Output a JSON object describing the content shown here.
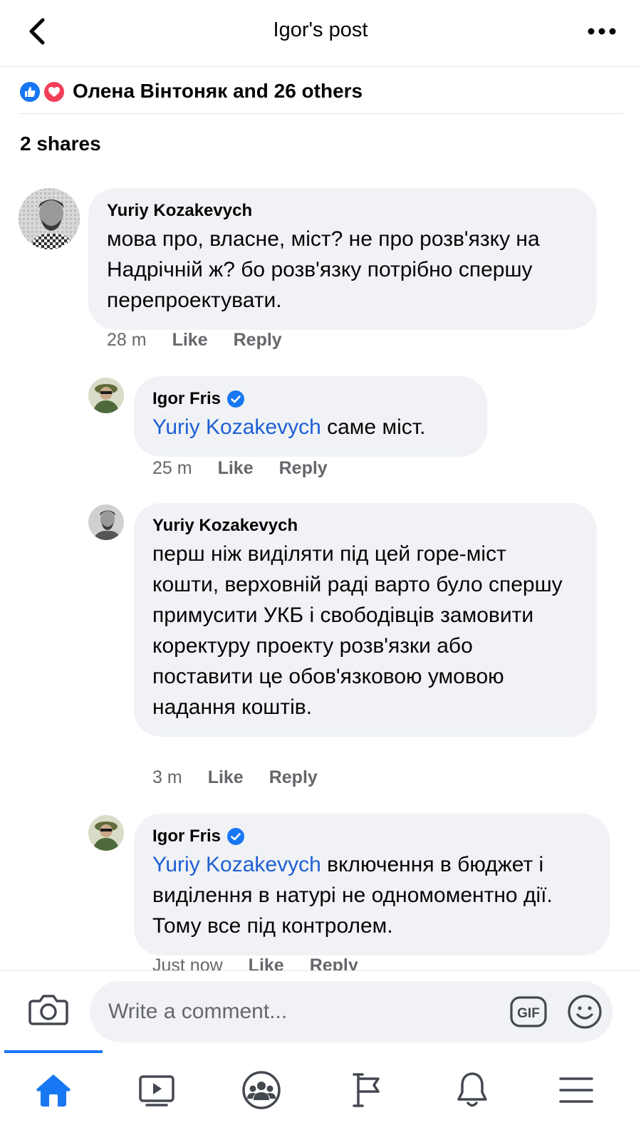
{
  "header": {
    "title": "Igor's post",
    "back_icon": "chevron-left-icon",
    "more_icon": "more-horizontal-icon"
  },
  "reactions": {
    "text": "Олена Вінтоняк and 26 others",
    "icons": [
      "like-reaction-icon",
      "love-reaction-icon"
    ]
  },
  "shares": "2 shares",
  "comments": [
    {
      "author": "Yuriy Kozakevych",
      "verified": false,
      "mention": "",
      "text": "мова про, власне, міст? не про розв'язку на Надрічній ж? бо розв'язку потрібно спершу перепроектувати.",
      "time": "28 m",
      "like_label": "Like",
      "reply_label": "Reply"
    },
    {
      "author": "Igor Fris",
      "verified": true,
      "mention": "Yuriy Kozakevych",
      "text": "саме міст.",
      "time": "25 m",
      "like_label": "Like",
      "reply_label": "Reply"
    },
    {
      "author": "Yuriy Kozakevych",
      "verified": false,
      "mention": "",
      "text": "перш ніж виділяти під цей горе-міст кошти, верховній раді варто було спершу примусити УКБ і свободівців замовити коректуру проекту розв'язки або поставити це обов'язковою умовою надання коштів.",
      "time": "3 m",
      "like_label": "Like",
      "reply_label": "Reply"
    },
    {
      "author": "Igor Fris",
      "verified": true,
      "mention": "Yuriy Kozakevych",
      "text": "включення в бюджет і виділення в натурі не одномоментно дії. Тому все під контролем.",
      "time": "Just now",
      "like_label": "Like",
      "reply_label": "Reply"
    }
  ],
  "composer": {
    "placeholder": "Write a comment...",
    "gif_label": "GIF",
    "camera_icon": "camera-icon",
    "emoji_icon": "emoji-icon"
  },
  "nav": {
    "items": [
      "home-icon",
      "video-icon",
      "groups-icon",
      "pages-flag-icon",
      "notifications-bell-icon",
      "menu-icon"
    ],
    "active": "home-icon"
  },
  "colors": {
    "accent": "#1877f2",
    "mention": "#1e5fd4",
    "bubble": "#f0f2f5",
    "meta": "#65676b",
    "love": "#f33e58"
  }
}
